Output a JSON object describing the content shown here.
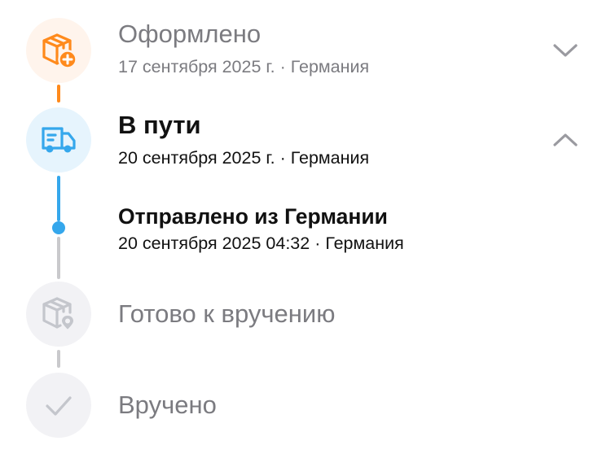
{
  "colors": {
    "orange": "#ff8a1c",
    "orange_bg": "#fff4ec",
    "blue": "#35a7ec",
    "blue_bg": "#e6f4fd",
    "grey_line": "#c9c9cc",
    "grey_bg": "#f2f2f5",
    "grey_icon": "#c4c6cc",
    "text_dark": "#111111",
    "text_grey": "#7b7b80"
  },
  "steps": [
    {
      "title": "Оформлено",
      "date": "17 сентября 2025 г.",
      "location": "Германия",
      "icon": "box-plus-icon",
      "status": "done",
      "toggle": "chevron-down-icon"
    },
    {
      "title": "В пути",
      "date": "20 сентября 2025 г.",
      "location": "Германия",
      "icon": "truck-icon",
      "status": "current",
      "toggle": "chevron-up-icon"
    },
    {
      "title": "Готово к вручению",
      "icon": "box-location-icon",
      "status": "pending"
    },
    {
      "title": "Вручено",
      "icon": "check-icon",
      "status": "pending"
    }
  ],
  "sub_event": {
    "title": "Отправлено из Германии",
    "datetime": "20 сентября 2025 04:32",
    "location": "Германия"
  }
}
